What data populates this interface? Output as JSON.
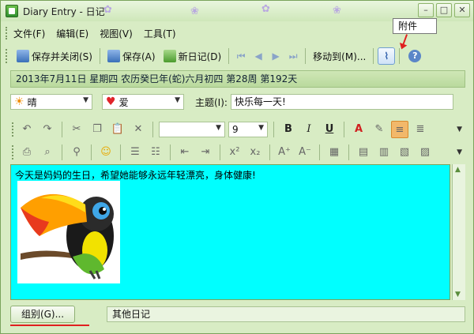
{
  "window": {
    "title": "Diary Entry - 日记",
    "min": "–",
    "max": "□",
    "close": "✕"
  },
  "menu": [
    "文件(F)",
    "编辑(E)",
    "视图(V)",
    "工具(T)"
  ],
  "toolbar": {
    "save_close": "保存并关闭(S)",
    "save": "保存(A)",
    "new_diary": "新日记(D)",
    "move_to": "移动到(M)...",
    "attachment_tooltip": "附件",
    "help": "?"
  },
  "date_line": "2013年7月11日 星期四 农历癸巳年(蛇)六月初四  第28周 第192天",
  "mood": {
    "weather": "晴",
    "feeling": "爱",
    "subject_label": "主题(I):",
    "subject": "快乐每一天!"
  },
  "format": {
    "font_size": "9",
    "bold": "B",
    "italic": "I",
    "underline": "U"
  },
  "editor": {
    "text": "今天是妈妈的生日，希望她能够永远年轻漂亮，身体健康!"
  },
  "group": {
    "button": "组别(G)...",
    "value": "其他日记"
  },
  "colors": {
    "window_bg": "#d8ecc4",
    "editor_bg": "#00ffff",
    "accent_red": "#e02020"
  }
}
